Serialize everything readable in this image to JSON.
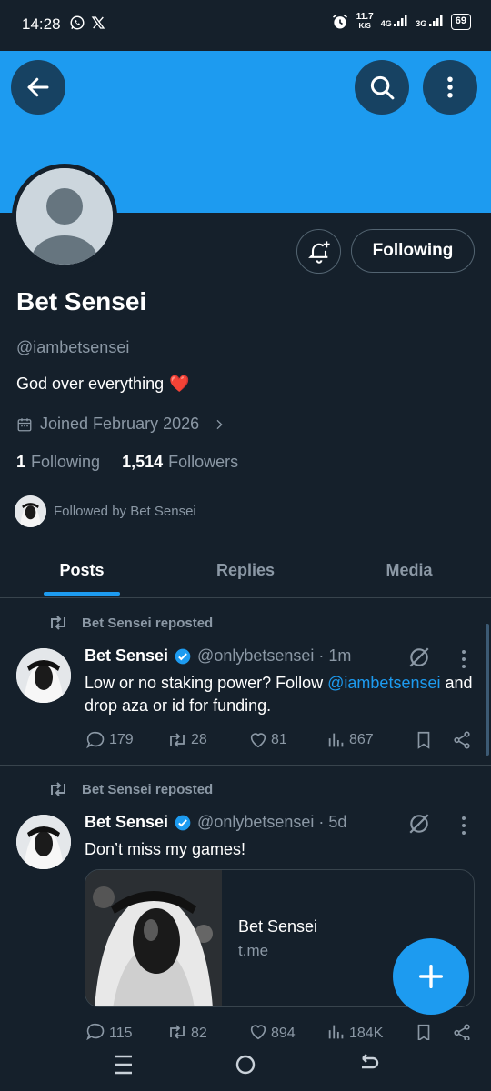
{
  "status_bar": {
    "time": "14:28",
    "speed_value": "11.7",
    "speed_unit": "K/S",
    "net1": "4G",
    "net2": "3G",
    "battery": "69"
  },
  "header": {
    "back_icon": "arrow-left-icon",
    "search_icon": "search-icon",
    "more_icon": "more-vertical-icon",
    "banner_color": "#1d9bf0"
  },
  "profile": {
    "name": "Bet Sensei",
    "handle": "@iambetsensei",
    "bio": "God over everything",
    "bio_emoji": "❤️",
    "joined": "Joined February 2026",
    "following_count": "1",
    "following_label": "Following",
    "followers_count": "1,514",
    "followers_label": "Followers",
    "followed_by": "Followed by Bet Sensei",
    "follow_button": "Following"
  },
  "tabs": [
    {
      "label": "Posts",
      "active": true
    },
    {
      "label": "Replies",
      "active": false
    },
    {
      "label": "Media",
      "active": false
    }
  ],
  "posts": [
    {
      "repost_label": "Bet Sensei reposted",
      "author": "Bet Sensei",
      "handle_time": "@onlybetsensei · 1m",
      "text_before": "Low or no staking power? Follow ",
      "mention": "@iambetsensei",
      "text_after": " and drop aza or id for funding.",
      "replies": "179",
      "reposts": "28",
      "likes": "81",
      "views": "867"
    },
    {
      "repost_label": "Bet Sensei reposted",
      "author": "Bet Sensei",
      "handle_time": "@onlybetsensei · 5d",
      "text": "Don’t miss my games!",
      "card_title": "Bet Sensei",
      "card_domain": "t.me",
      "replies": "115",
      "reposts": "82",
      "likes": "894",
      "views": "184K"
    }
  ],
  "colors": {
    "background": "#15202b",
    "accent": "#1d9bf0",
    "muted": "#8b98a5",
    "border": "#38444d"
  }
}
